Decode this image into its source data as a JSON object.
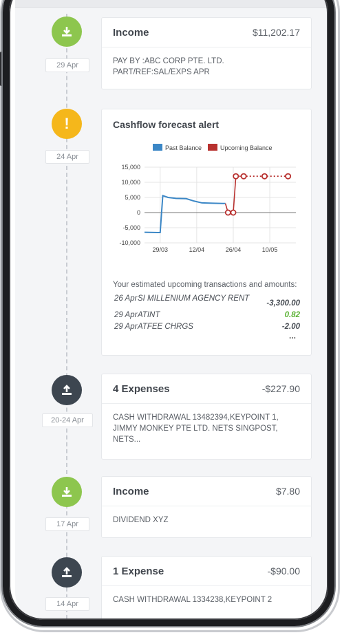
{
  "timeline": [
    {
      "kind": "income",
      "date": "29 Apr",
      "title": "Income",
      "amount": "$11,202.17",
      "details": "PAY BY :ABC CORP PTE. LTD. PART/REF:SAL/EXPS APR"
    },
    {
      "kind": "alert",
      "date": "24 Apr",
      "title": "Cashflow forecast alert",
      "intro": "Your estimated upcoming transactions and amounts:",
      "transactions": [
        {
          "date": "26 Apr",
          "desc": "SI MILLENIUM AGENCY RENT",
          "amount": "-3,300.00",
          "positive": false
        },
        {
          "date": "29 Apr",
          "desc": "ATINT",
          "amount": "0.82",
          "positive": true
        },
        {
          "date": "29 Apr",
          "desc": "ATFEE CHRGS",
          "amount": "-2.00",
          "positive": false
        }
      ],
      "more": "..."
    },
    {
      "kind": "expense",
      "date": "20-24 Apr",
      "title": "4 Expenses",
      "amount": "-$227.90",
      "details": "CASH WITHDRAWAL 13482394,KEYPOINT 1, JIMMY MONKEY PTE LTD. NETS SINGPOST, NETS..."
    },
    {
      "kind": "income",
      "date": "17 Apr",
      "title": "Income",
      "amount": "$7.80",
      "details": "DIVIDEND XYZ"
    },
    {
      "kind": "expense",
      "date": "14 Apr",
      "title": "1 Expense",
      "amount": "-$90.00",
      "details": "CASH WITHDRAWAL 1334238,KEYPOINT 2"
    }
  ],
  "colors": {
    "income": "#8dc64e",
    "alert": "#f5b71b",
    "expense": "#3d4650",
    "past_balance": "#3b87c6",
    "upcoming_balance": "#b8312f",
    "positive_amount": "#5ab233"
  },
  "icons": {
    "income": "download-icon",
    "alert": "exclamation-icon",
    "expense": "upload-icon"
  },
  "chart_data": {
    "type": "line",
    "title": "",
    "xlabel": "",
    "ylabel": "",
    "legend_position": "top",
    "ylim": [
      -10000,
      15000
    ],
    "y_ticks": [
      "15,000",
      "10,000",
      "5,000",
      "0",
      "-5,000",
      "-10,000"
    ],
    "y_tick_values": [
      15000,
      10000,
      5000,
      0,
      -5000,
      -10000
    ],
    "x_ticks": [
      "29/03",
      "12/04",
      "26/04",
      "10/05"
    ],
    "x_tick_days": [
      0,
      14,
      28,
      42
    ],
    "x_unit": "days",
    "series": [
      {
        "name": "Past Balance",
        "color": "#3b87c6",
        "markers": false,
        "points": [
          [
            -6,
            -6500
          ],
          [
            -1,
            -6600
          ],
          [
            0,
            -6600
          ],
          [
            1,
            5600
          ],
          [
            3,
            5000
          ],
          [
            6,
            4700
          ],
          [
            10,
            4600
          ],
          [
            13,
            3800
          ],
          [
            16,
            3200
          ],
          [
            20,
            3100
          ],
          [
            24,
            3000
          ],
          [
            25,
            3000
          ]
        ]
      },
      {
        "name": "Upcoming Balance",
        "color": "#b8312f",
        "markers": true,
        "dashed_from_index": 3,
        "points": [
          [
            25,
            3000
          ],
          [
            26,
            0
          ],
          [
            28,
            0
          ],
          [
            29,
            12000
          ],
          [
            32,
            12000
          ],
          [
            40,
            12000
          ],
          [
            49,
            12000
          ]
        ]
      }
    ]
  }
}
